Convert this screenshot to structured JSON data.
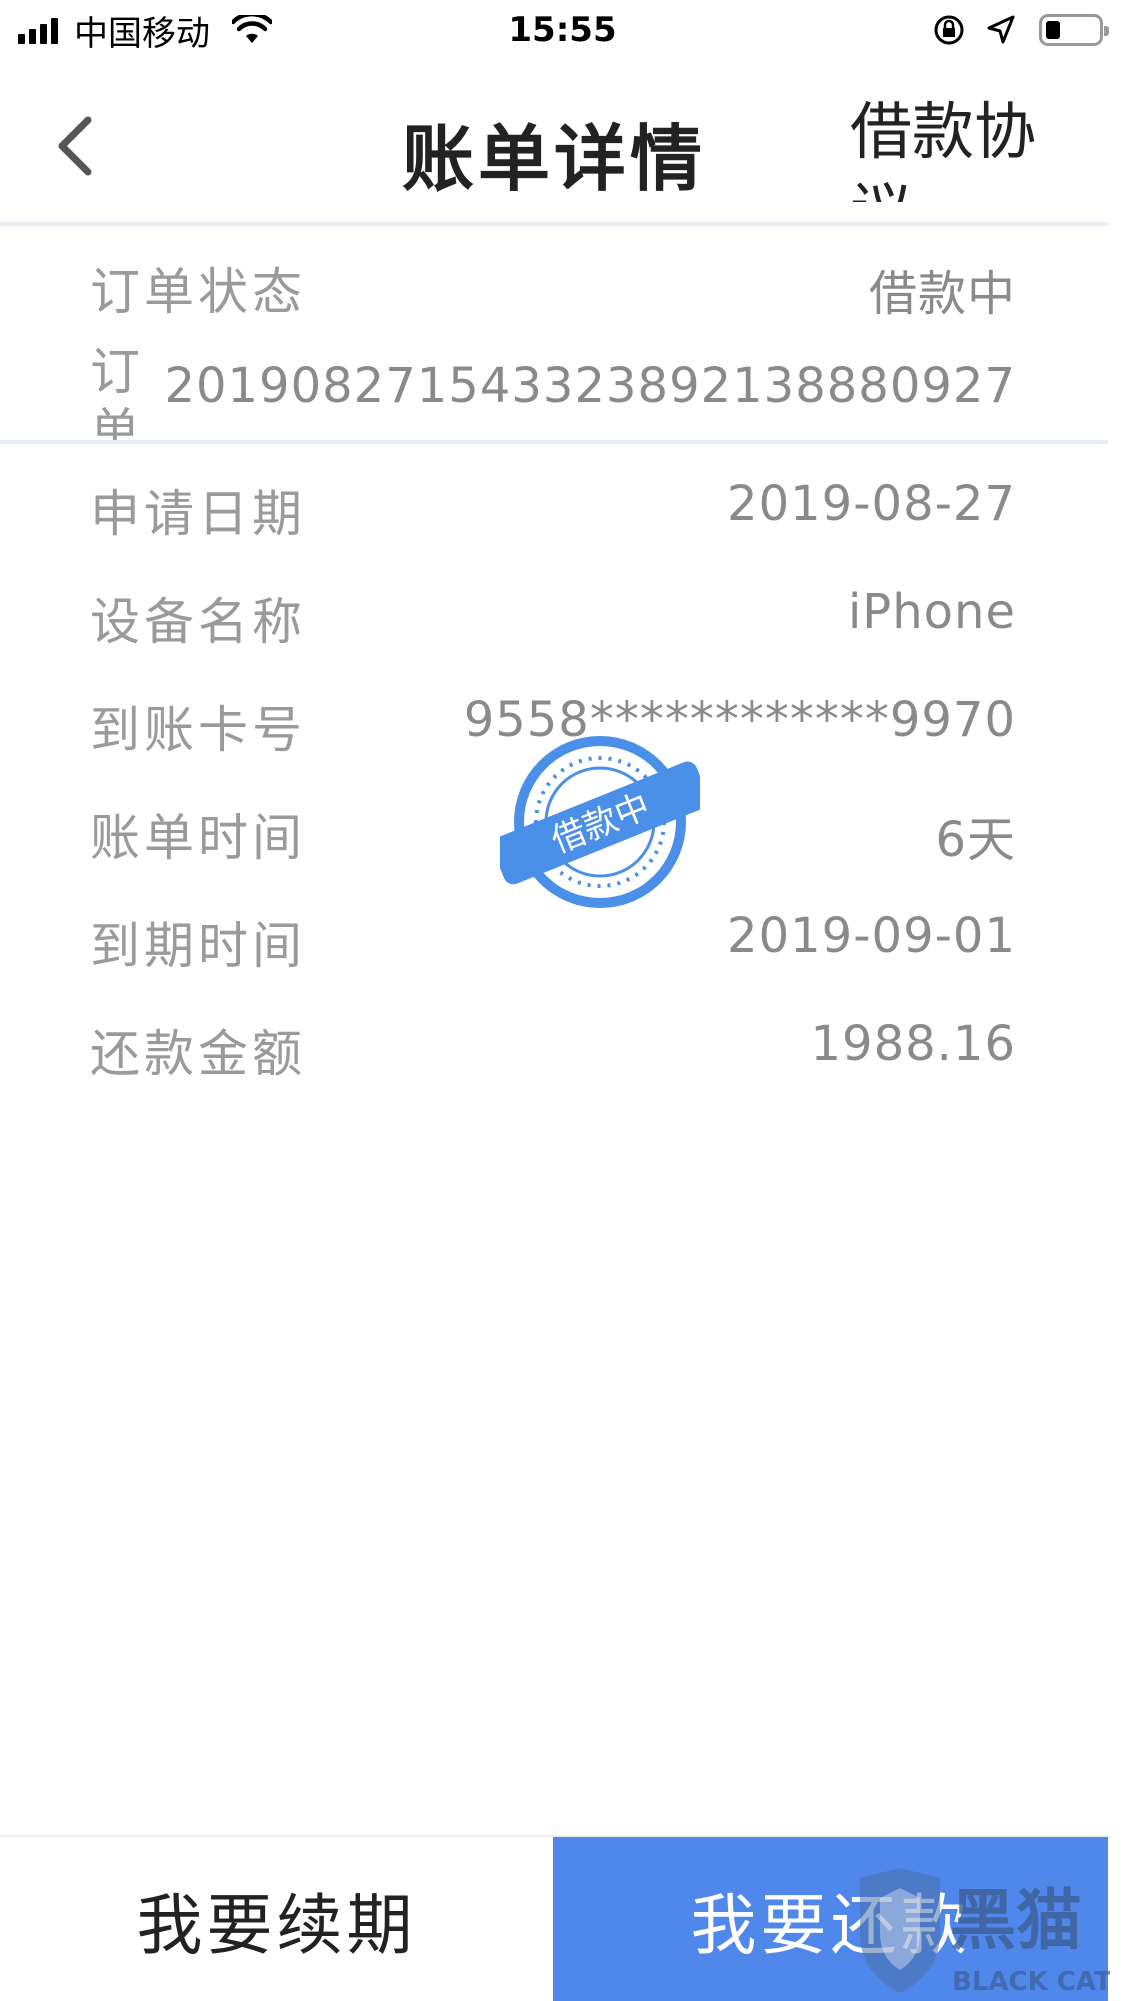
{
  "status_bar": {
    "carrier": "中国移动",
    "time": "15:55"
  },
  "nav": {
    "title": "账单详情",
    "right_action": "借款协议"
  },
  "order_status": {
    "label": "订单状态",
    "value": "借款中"
  },
  "order_number": {
    "label": "订单",
    "value": "20190827154332389213888092​7"
  },
  "rows": [
    {
      "label": "申请日期",
      "value": "2019-08-27"
    },
    {
      "label": "设备名称",
      "value": "iPhone"
    },
    {
      "label": "到账卡号",
      "value": "9558************9970"
    },
    {
      "label": "账单时间",
      "value": "6天"
    },
    {
      "label": "到期时间",
      "value": "2019-09-01"
    },
    {
      "label": "还款金额",
      "value": "1988.16"
    }
  ],
  "stamp": {
    "text": "借款中",
    "color": "#4a8fe8"
  },
  "buttons": {
    "renew": "我要续期",
    "repay": "我要还款"
  },
  "watermark": {
    "text": "黑猫",
    "sub": "BLACK CAT"
  },
  "colors": {
    "accent": "#4f87ea",
    "label": "#9a9a9a",
    "value": "#8a8a8a"
  }
}
